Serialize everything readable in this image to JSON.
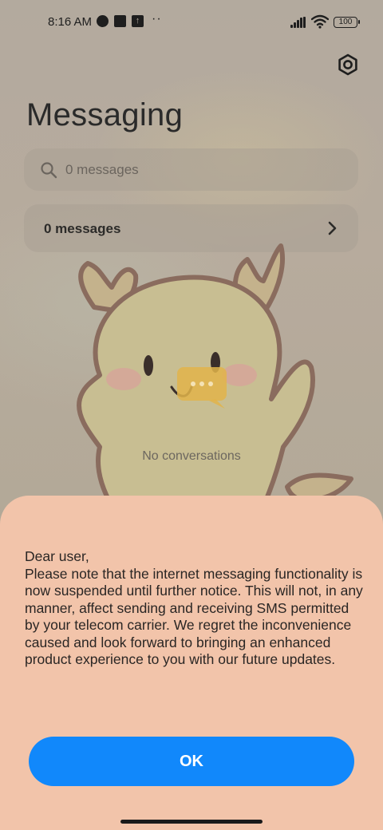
{
  "status_bar": {
    "time": "8:16 AM",
    "battery": "100",
    "overflow": "··"
  },
  "header": {
    "title": "Messaging",
    "settings_icon": "gear-icon"
  },
  "search": {
    "placeholder": "0 messages",
    "icon": "search-icon"
  },
  "summary": {
    "label": "0 messages",
    "icon": "chevron-right-icon"
  },
  "empty_state": {
    "text": "No conversations"
  },
  "dialog": {
    "greeting": "Dear user,",
    "body": "Please note that the internet messaging functionality is now suspended until further notice. This will not, in any manner, affect sending and receiving SMS permitted by your telecom carrier. We regret the inconvenience caused and look forward to bringing an enhanced product experience to you with our future updates.",
    "ok_label": "OK"
  },
  "colors": {
    "accent": "#1188fb",
    "sheet_background": "#f2c4aa",
    "scrim_background": "#b4aa9c"
  }
}
